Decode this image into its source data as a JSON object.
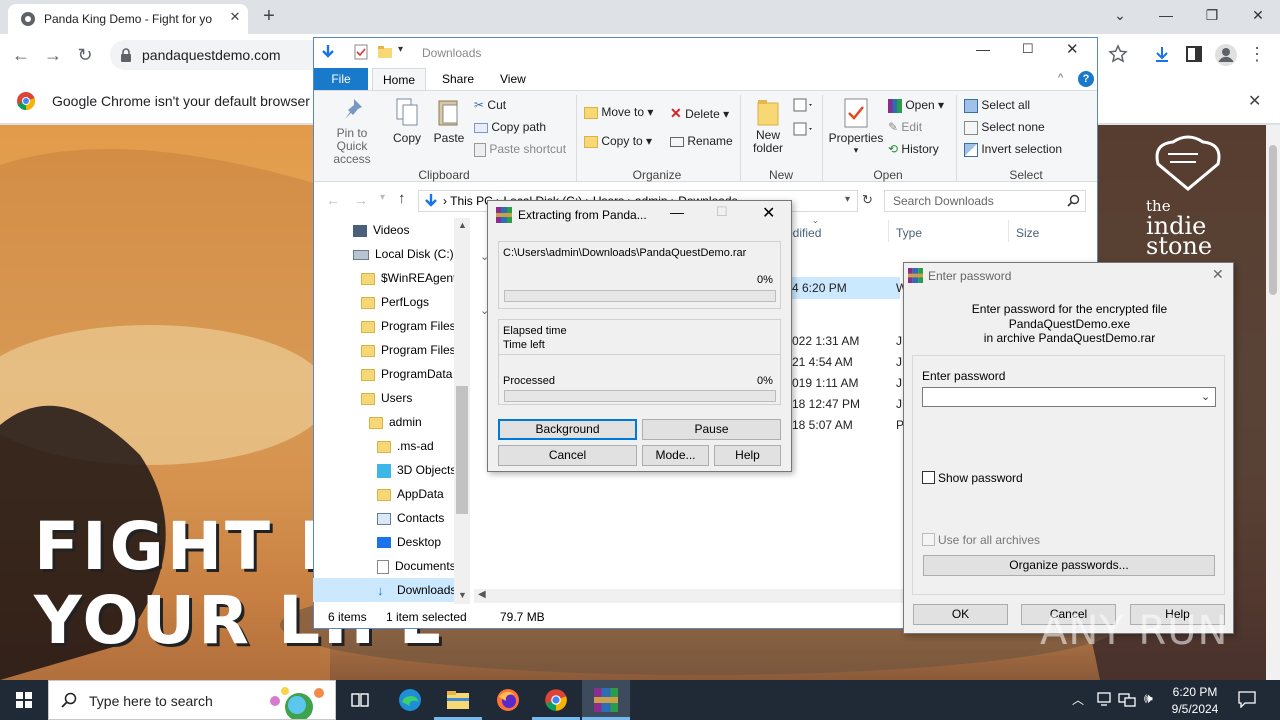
{
  "chrome": {
    "tab_title": "Panda King Demo - Fight for yo",
    "tab_close": "✕",
    "new_tab": "+",
    "url": "pandaquestdemo.com",
    "infobar_text": "Google Chrome isn't your default browser",
    "infobar_close": "✕"
  },
  "page": {
    "headline_line1": "FIGHT FOR",
    "headline_line2": "YOUR LIFE",
    "logo_text_1": "the",
    "logo_text_2": "indie stone"
  },
  "explorer": {
    "title": "Downloads",
    "tabs": [
      "File",
      "Home",
      "Share",
      "View"
    ],
    "clipboard": {
      "pin_label": "Pin to Quick access",
      "copy_label": "Copy",
      "paste_label": "Paste",
      "cut_label": "Cut",
      "copy_path_label": "Copy path",
      "paste_shortcut_label": "Paste shortcut",
      "group_label": "Clipboard"
    },
    "organize": {
      "move_to": "Move to",
      "copy_to": "Copy to",
      "delete": "Delete",
      "rename": "Rename",
      "group_label": "Organize"
    },
    "new": {
      "new_folder": "New folder",
      "group_label": "New"
    },
    "open": {
      "properties": "Properties",
      "open": "Open",
      "edit": "Edit",
      "history": "History",
      "group_label": "Open"
    },
    "select": {
      "select_all": "Select all",
      "select_none": "Select none",
      "invert": "Invert selection",
      "group_label": "Select"
    },
    "address_crumbs": [
      "This PC",
      "Local Disk (C:)",
      "Users",
      "admin",
      "Downloads"
    ],
    "search_placeholder": "Search Downloads",
    "columns": {
      "modified": "odified",
      "type": "Type",
      "size": "Size"
    },
    "file_dates": [
      "4 6:20 PM",
      "022 1:31 AM",
      "21 4:54 AM",
      "019 1:11 AM",
      "18 12:47 PM",
      "18 5:07 AM"
    ],
    "file_types": [
      "W",
      "JP",
      "JP",
      "JP",
      "JP",
      "PI"
    ],
    "tree": [
      {
        "label": "Videos",
        "indent": 0
      },
      {
        "label": "Local Disk (C:)",
        "indent": 0
      },
      {
        "label": "$WinREAgent",
        "indent": 1
      },
      {
        "label": "PerfLogs",
        "indent": 1
      },
      {
        "label": "Program Files",
        "indent": 1
      },
      {
        "label": "Program Files",
        "indent": 1
      },
      {
        "label": "ProgramData",
        "indent": 1
      },
      {
        "label": "Users",
        "indent": 1
      },
      {
        "label": "admin",
        "indent": 2
      },
      {
        "label": ".ms-ad",
        "indent": 3
      },
      {
        "label": "3D Objects",
        "indent": 3
      },
      {
        "label": "AppData",
        "indent": 3
      },
      {
        "label": "Contacts",
        "indent": 3
      },
      {
        "label": "Desktop",
        "indent": 3
      },
      {
        "label": "Documents",
        "indent": 3
      },
      {
        "label": "Downloads",
        "indent": 3
      }
    ],
    "status_items": "6 items",
    "status_selected": "1 item selected",
    "status_size": "79.7 MB"
  },
  "extract_dialog": {
    "title": "Extracting from Panda...",
    "path": "C:\\Users\\admin\\Downloads\\PandaQuestDemo.rar",
    "file_percent": "0%",
    "elapsed_label": "Elapsed time",
    "time_left_label": "Time left",
    "processed_label": "Processed",
    "processed_percent": "0%",
    "progress": 0,
    "buttons": {
      "background": "Background",
      "pause": "Pause",
      "cancel": "Cancel",
      "mode": "Mode...",
      "help": "Help"
    }
  },
  "password_dialog": {
    "title": "Enter password",
    "message_line1": "Enter password for the encrypted file",
    "message_line2": "PandaQuestDemo.exe",
    "message_line3": "in archive PandaQuestDemo.rar",
    "field_label": "Enter password",
    "field_value": "",
    "show_password": "Show password",
    "use_for_all": "Use for all archives",
    "organize": "Organize passwords...",
    "ok": "OK",
    "cancel": "Cancel",
    "help": "Help"
  },
  "taskbar": {
    "search_placeholder": "Type here to search",
    "time": "6:20 PM",
    "date": "9/5/2024"
  },
  "watermark": "ANY RUN"
}
